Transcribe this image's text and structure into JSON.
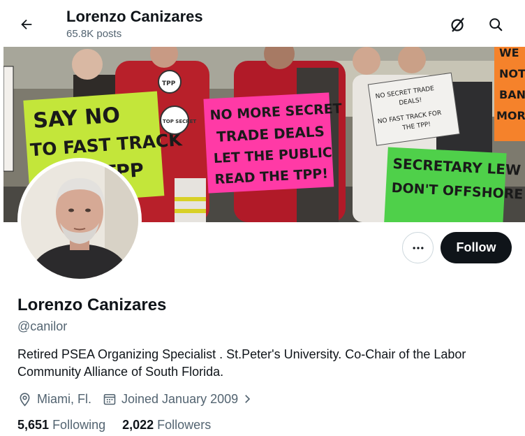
{
  "header": {
    "name": "Lorenzo Canizares",
    "posts": "65.8K posts"
  },
  "banner": {
    "signs": [
      "SAY NO",
      "TO FAST TRACK",
      "TPP",
      "NO MORE SECRET",
      "TRADE DEALS",
      "LET THE PUBLIC",
      "READ THE TPP!",
      "NO SECRET TRADE",
      "DEALS!",
      "NO FAST TRACK FOR",
      "THE TPP!",
      "SECRETARY LEW",
      "DON'T OFFSHORE",
      "WE",
      "NOT",
      "BAN",
      "MORE",
      "TPP",
      "TOP SECRET"
    ]
  },
  "profile": {
    "display_name": "Lorenzo Canizares",
    "handle": "@canilor",
    "bio": "Retired PSEA Organizing Specialist . St.Peter's University. Co-Chair of the Labor Community Alliance of South Florida.",
    "location": "Miami, Fl.",
    "joined": "Joined January 2009",
    "following_count": "5,651",
    "following_label": "Following",
    "followers_count": "2,022",
    "followers_label": "Followers"
  },
  "actions": {
    "follow_label": "Follow"
  },
  "icons": {
    "back": "back-arrow-icon",
    "grok": "grok-icon",
    "search": "search-icon",
    "more": "more-horizontal-icon",
    "location": "location-pin-icon",
    "calendar": "calendar-icon",
    "chevron": "chevron-right-icon"
  },
  "colors": {
    "text_primary": "#0f1419",
    "text_secondary": "#536471",
    "follow_bg": "#0f1419",
    "follow_text": "#ffffff",
    "border": "#cfd9de"
  }
}
